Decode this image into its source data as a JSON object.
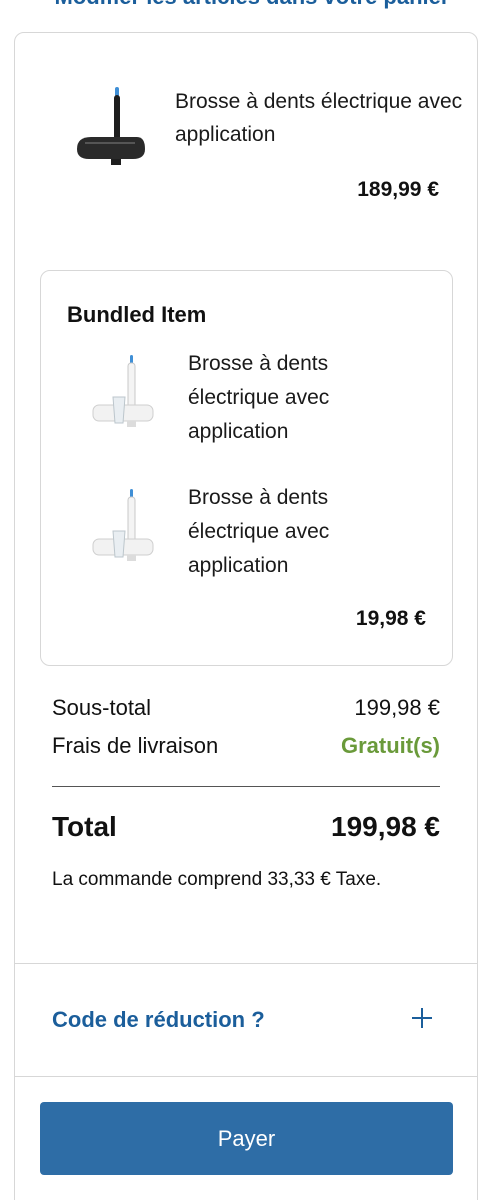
{
  "header": {
    "link_text": "Modifier les articles dans votre panier"
  },
  "cart": {
    "main_item": {
      "title": "Brosse à dents électrique avec application",
      "price": "189,99 €",
      "image": "dark-toothbrush-with-case"
    },
    "bundle": {
      "title": "Bundled Item",
      "items": [
        {
          "title": "Brosse à dents électrique avec application",
          "image": "white-toothbrush-with-glass"
        },
        {
          "title": "Brosse à dents électrique avec application",
          "image": "white-toothbrush-with-glass"
        }
      ],
      "price": "19,98 €"
    }
  },
  "summary": {
    "subtotal_label": "Sous-total",
    "subtotal_value": "199,98 €",
    "shipping_label": "Frais de livraison",
    "shipping_value": "Gratuit(s)",
    "total_label": "Total",
    "total_value": "199,98 €",
    "tax_note": "La commande comprend 33,33 € Taxe."
  },
  "discount": {
    "label": "Code de réduction ?",
    "icon": "plus-icon"
  },
  "actions": {
    "pay_label": "Payer"
  },
  "colors": {
    "accent": "#1b5e9b",
    "button": "#2e6da6",
    "free_shipping": "#6a9a3a",
    "border": "#d7d7d7"
  }
}
